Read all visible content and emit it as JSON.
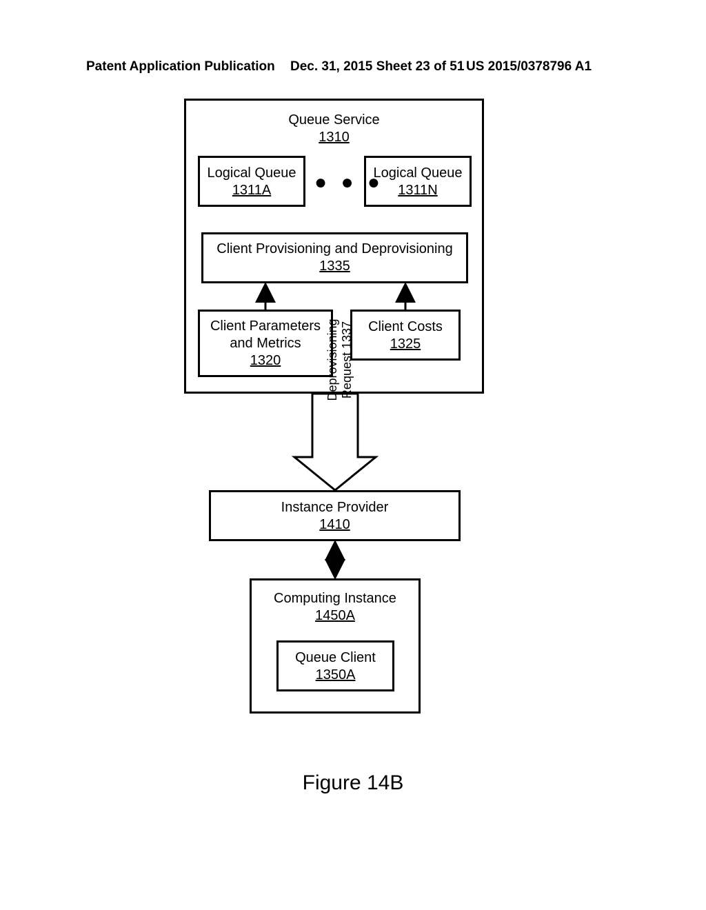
{
  "header": {
    "left": "Patent Application Publication",
    "mid": "Dec. 31, 2015  Sheet 23 of 51",
    "right": "US 2015/0378796 A1"
  },
  "queue_service": {
    "title": "Queue Service",
    "ref": "1310"
  },
  "logical_queue_a": {
    "title": "Logical Queue",
    "ref": "1311A"
  },
  "logical_queue_n": {
    "title": "Logical Queue",
    "ref": "1311N"
  },
  "ellipsis": "● ● ●",
  "client_prov_deprov": {
    "title": "Client Provisioning and Deprovisioning",
    "ref": "1335"
  },
  "client_params_metrics": {
    "title_l1": "Client Parameters",
    "title_l2": "and Metrics",
    "ref": "1320"
  },
  "client_costs": {
    "title": "Client Costs",
    "ref": "1325"
  },
  "deprov_request": {
    "title": "Deprovisioning",
    "sub": "Request",
    "ref": "1337"
  },
  "instance_provider": {
    "title": "Instance Provider",
    "ref": "1410"
  },
  "computing_instance": {
    "title": "Computing Instance",
    "ref": "1450A"
  },
  "queue_client": {
    "title": "Queue Client",
    "ref": "1350A"
  },
  "figure_caption": "Figure 14B"
}
